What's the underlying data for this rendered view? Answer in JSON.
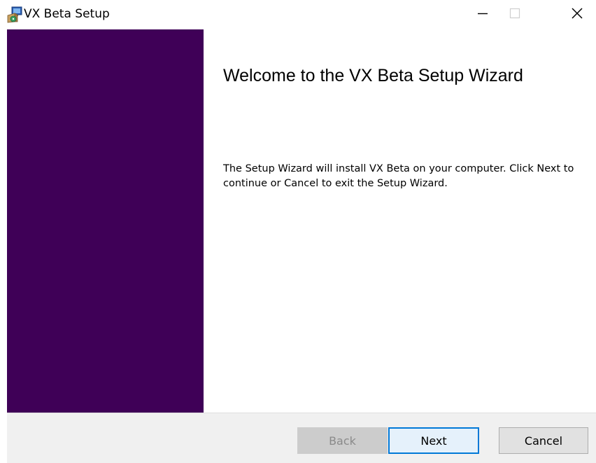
{
  "window": {
    "title": "VX Beta Setup",
    "app_icon": "installer-icon",
    "controls": {
      "minimize_icon": "minimize-icon",
      "maximize_icon": "maximize-icon",
      "close_icon": "close-icon"
    }
  },
  "banner": {
    "color": "#3f0057"
  },
  "main": {
    "heading": "Welcome to the VX Beta Setup Wizard",
    "description": "The Setup Wizard will install VX Beta on your computer. Click Next to continue or Cancel to exit the Setup Wizard."
  },
  "footer": {
    "back_label": "Back",
    "next_label": "Next",
    "cancel_label": "Cancel",
    "back_enabled": false
  },
  "colors": {
    "accent": "#0078d7",
    "footer_bg": "#f0f0f0"
  }
}
